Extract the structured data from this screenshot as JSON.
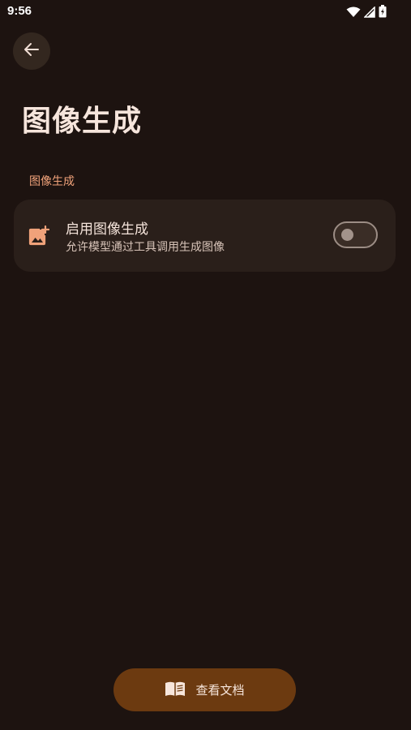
{
  "status_bar": {
    "time": "9:56",
    "icons": [
      "wifi-icon",
      "cellular-signal-icon",
      "battery-charging-icon"
    ]
  },
  "header": {
    "back_icon": "arrow-left-icon",
    "title": "图像生成"
  },
  "section": {
    "header": "图像生成"
  },
  "setting": {
    "icon": "add-image-icon",
    "title": "启用图像生成",
    "description": "允许模型通过工具调用生成图像",
    "enabled": false
  },
  "docs_button": {
    "icon": "book-icon",
    "label": "查看文档"
  },
  "colors": {
    "background": "#1d1310",
    "accent": "#f0a27a",
    "card": "#2a1f1a",
    "button": "#6c3a10"
  }
}
